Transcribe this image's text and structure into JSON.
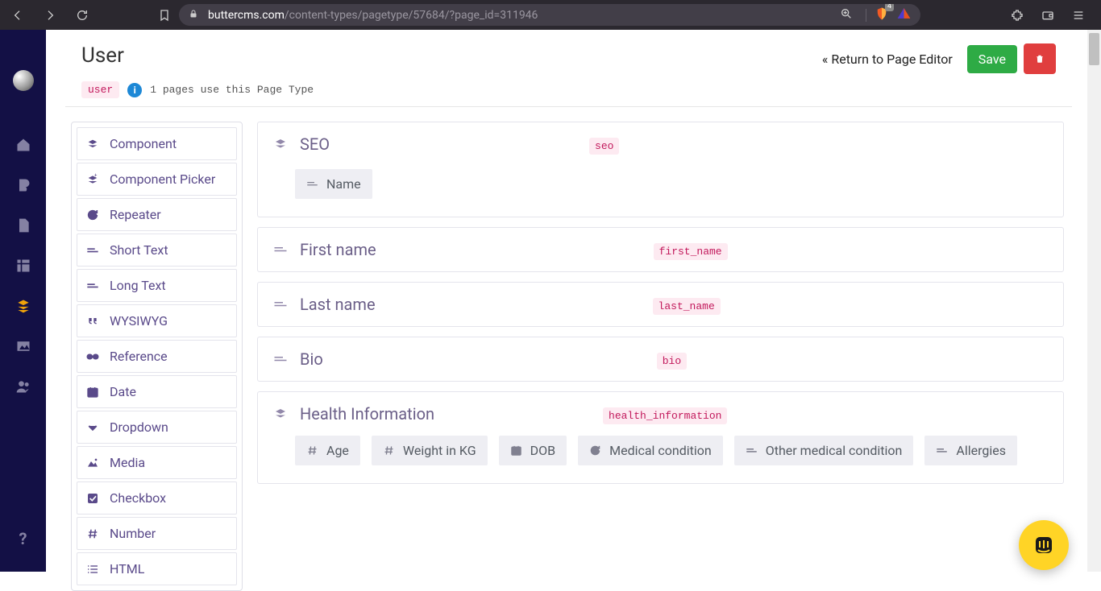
{
  "browser": {
    "url_host": "buttercms.com",
    "url_path": "/content-types/pagetype/57684/?page_id=311946",
    "shield_count": "4"
  },
  "header": {
    "title": "User",
    "slug": "user",
    "usage_text": "1 pages use this Page Type",
    "return_label": "Return to Page Editor",
    "save_label": "Save"
  },
  "palette": [
    {
      "icon": "layers",
      "label": "Component"
    },
    {
      "icon": "layers-plus",
      "label": "Component Picker"
    },
    {
      "icon": "repeat",
      "label": "Repeater"
    },
    {
      "icon": "short-text",
      "label": "Short Text"
    },
    {
      "icon": "short-text",
      "label": "Long Text"
    },
    {
      "icon": "quote",
      "label": "WYSIWYG"
    },
    {
      "icon": "link",
      "label": "Reference"
    },
    {
      "icon": "date",
      "label": "Date"
    },
    {
      "icon": "chevron-down",
      "label": "Dropdown"
    },
    {
      "icon": "image",
      "label": "Media"
    },
    {
      "icon": "check",
      "label": "Checkbox"
    },
    {
      "icon": "hash",
      "label": "Number"
    },
    {
      "icon": "list",
      "label": "HTML"
    }
  ],
  "fields": {
    "seo": {
      "title": "SEO",
      "slug": "seo",
      "children": [
        {
          "icon": "short-text",
          "label": "Name"
        }
      ]
    },
    "first_name": {
      "title": "First name",
      "slug": "first_name",
      "icon": "short-text"
    },
    "last_name": {
      "title": "Last name",
      "slug": "last_name",
      "icon": "short-text"
    },
    "bio": {
      "title": "Bio",
      "slug": "bio",
      "icon": "short-text"
    },
    "health": {
      "title": "Health Information",
      "slug": "health_information",
      "children": [
        {
          "icon": "hash",
          "label": "Age"
        },
        {
          "icon": "hash",
          "label": "Weight in KG"
        },
        {
          "icon": "date",
          "label": "DOB"
        },
        {
          "icon": "repeat",
          "label": "Medical condition"
        },
        {
          "icon": "short-text",
          "label": "Other medical condition"
        },
        {
          "icon": "short-text",
          "label": "Allergies"
        }
      ]
    }
  }
}
